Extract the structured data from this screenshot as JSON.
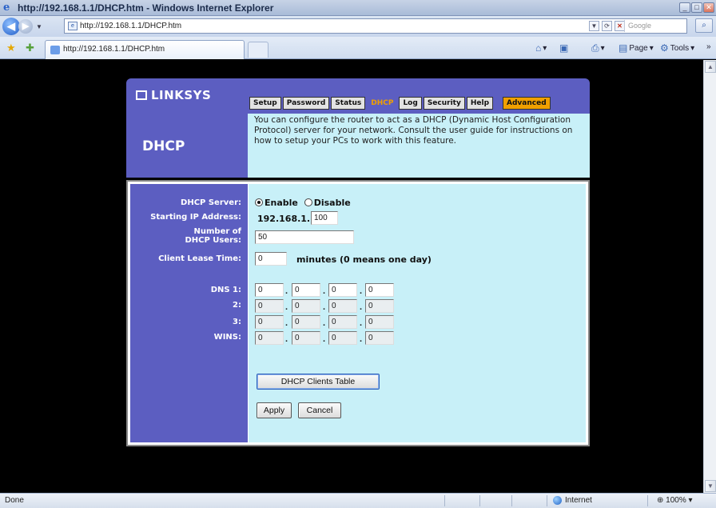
{
  "window": {
    "title": "http://192.168.1.1/DHCP.htm - Windows Internet Explorer",
    "minimize": "_",
    "maximize": "□",
    "close": "✕"
  },
  "addressbar": {
    "url": "http://192.168.1.1/DHCP.htm",
    "search_placeholder": "Google",
    "search_button": "⌕"
  },
  "tabbar": {
    "tab_title": "http://192.168.1.1/DHCP.htm",
    "cmd_page": "Page",
    "cmd_tools": "Tools",
    "overflow": "»"
  },
  "router": {
    "brand": "LINKSYS",
    "page_title": "DHCP",
    "tabs": [
      "Setup",
      "Password",
      "Status",
      "DHCP",
      "Log",
      "Security",
      "Help"
    ],
    "active_tab": "DHCP",
    "advanced_tab": "Advanced",
    "intro": "You can configure the router to act as a DHCP (Dynamic Host Configuration Protocol) server for your network. Consult the user guide for instructions on how to setup your PCs to work with this feature.",
    "form": {
      "dhcp_server_label": "DHCP Server:",
      "enable_label": "Enable",
      "disable_label": "Disable",
      "dhcp_enabled": true,
      "start_ip_label": "Starting IP Address:",
      "start_ip_prefix": "192.168.1.",
      "start_ip_last": "100",
      "num_users_label_1": "Number of",
      "num_users_label_2": "DHCP Users:",
      "num_users": "50",
      "lease_label": "Client Lease Time:",
      "lease_value": "0",
      "lease_suffix": "minutes (0 means one day)",
      "dns1_label": "DNS 1:",
      "dns2_label": "2:",
      "dns3_label": "3:",
      "wins_label": "WINS:",
      "dns1": [
        "0",
        "0",
        "0",
        "0"
      ],
      "dns2": [
        "0",
        "0",
        "0",
        "0"
      ],
      "dns3": [
        "0",
        "0",
        "0",
        "0"
      ],
      "wins": [
        "0",
        "0",
        "0",
        "0"
      ],
      "dot": ".",
      "clients_table_button": "DHCP Clients Table",
      "apply_button": "Apply",
      "cancel_button": "Cancel"
    }
  },
  "statusbar": {
    "status": "Done",
    "zone": "Internet",
    "zoom": "100%"
  },
  "colors": {
    "linksys_blue": "#5c5ec1",
    "panel_cyan": "#c8f0f8",
    "active_tab_text": "#f0a000"
  }
}
